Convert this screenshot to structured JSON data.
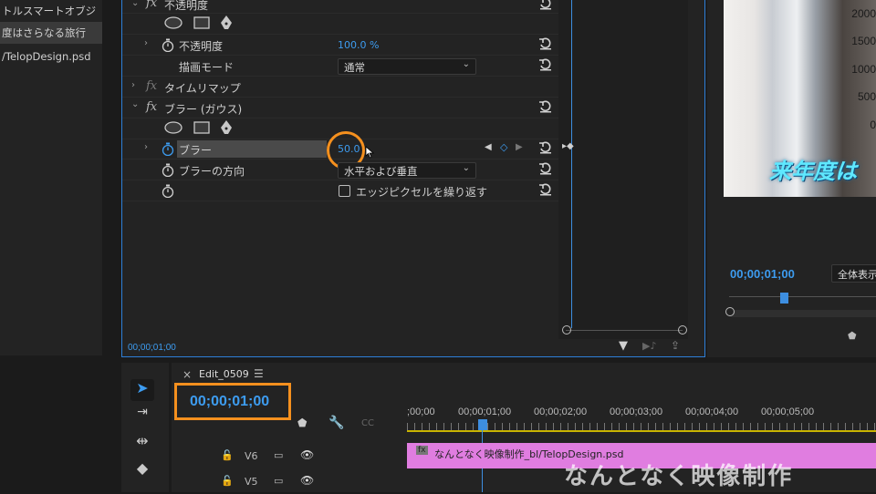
{
  "project_panel": {
    "items": [
      "トルスマートオブジ",
      "度はさらなる旅行",
      "/TelopDesign.psd"
    ]
  },
  "effect_controls": {
    "sections": {
      "opacity": {
        "title": "不透明度",
        "prop_label": "不透明度",
        "prop_value": "100.0 %",
        "blend_label": "描画モード",
        "blend_value": "通常"
      },
      "time_remap": {
        "title": "タイムリマップ"
      },
      "blur": {
        "title": "ブラー (ガウス)",
        "prop_label": "ブラー",
        "prop_value": "50.0",
        "dir_label": "ブラーの方向",
        "dir_value": "水平および垂直",
        "repeat_label": "エッジピクセルを繰り返す"
      }
    },
    "timecode": "00;00;01;00"
  },
  "program_monitor": {
    "y_labels": [
      "2000",
      "1500",
      "1000",
      "500",
      "0"
    ],
    "telop": "来年度は",
    "timecode": "00;00;01;00",
    "fit_label": "全体表示"
  },
  "timeline": {
    "sequence_name": "Edit_0509",
    "timecode": "00;00;01;00",
    "ruler": [
      ";00;00",
      "00;00;01;00",
      "00;00;02;00",
      "00;00;03;00",
      "00;00;04;00",
      "00;00;05;00"
    ],
    "tracks": [
      {
        "name": "V6"
      },
      {
        "name": "V5"
      }
    ],
    "clip_name": "なんとなく映像制作_bl/TelopDesign.psd",
    "watermark": "なんとなく映像制作"
  },
  "colors": {
    "accent": "#2d7fd8",
    "highlight": "#f5901e",
    "clip": "#e07de0",
    "timecode": "#3d9cf0"
  }
}
